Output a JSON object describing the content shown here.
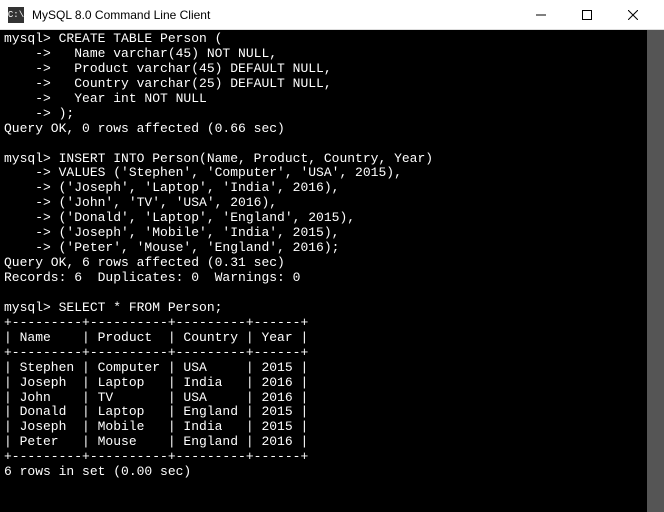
{
  "window": {
    "title": "MySQL 8.0 Command Line Client"
  },
  "terminal": {
    "lines": [
      "mysql> CREATE TABLE Person (",
      "    ->   Name varchar(45) NOT NULL,",
      "    ->   Product varchar(45) DEFAULT NULL,",
      "    ->   Country varchar(25) DEFAULT NULL,",
      "    ->   Year int NOT NULL",
      "    -> );",
      "Query OK, 0 rows affected (0.66 sec)",
      "",
      "mysql> INSERT INTO Person(Name, Product, Country, Year)",
      "    -> VALUES ('Stephen', 'Computer', 'USA', 2015),",
      "    -> ('Joseph', 'Laptop', 'India', 2016),",
      "    -> ('John', 'TV', 'USA', 2016),",
      "    -> ('Donald', 'Laptop', 'England', 2015),",
      "    -> ('Joseph', 'Mobile', 'India', 2015),",
      "    -> ('Peter', 'Mouse', 'England', 2016);",
      "Query OK, 6 rows affected (0.31 sec)",
      "Records: 6  Duplicates: 0  Warnings: 0",
      "",
      "mysql> SELECT * FROM Person;",
      "+---------+----------+---------+------+",
      "| Name    | Product  | Country | Year |",
      "+---------+----------+---------+------+",
      "| Stephen | Computer | USA     | 2015 |",
      "| Joseph  | Laptop   | India   | 2016 |",
      "| John    | TV       | USA     | 2016 |",
      "| Donald  | Laptop   | England | 2015 |",
      "| Joseph  | Mobile   | India   | 2015 |",
      "| Peter   | Mouse    | England | 2016 |",
      "+---------+----------+---------+------+",
      "6 rows in set (0.00 sec)"
    ]
  },
  "chart_data": {
    "type": "table",
    "title": "Person",
    "columns": [
      "Name",
      "Product",
      "Country",
      "Year"
    ],
    "rows": [
      [
        "Stephen",
        "Computer",
        "USA",
        2015
      ],
      [
        "Joseph",
        "Laptop",
        "India",
        2016
      ],
      [
        "John",
        "TV",
        "USA",
        2016
      ],
      [
        "Donald",
        "Laptop",
        "England",
        2015
      ],
      [
        "Joseph",
        "Mobile",
        "India",
        2015
      ],
      [
        "Peter",
        "Mouse",
        "England",
        2016
      ]
    ]
  }
}
